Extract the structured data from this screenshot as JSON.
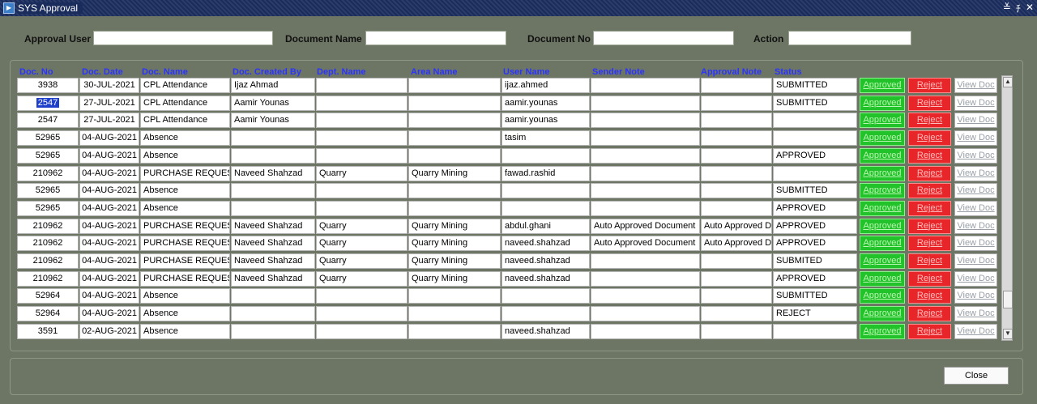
{
  "window": {
    "title": "SYS Approval",
    "buttons": [
      "≚",
      "ﾁ",
      "✕"
    ]
  },
  "filters": {
    "approval_user_label": "Approval User",
    "approval_user_value": "",
    "document_name_label": "Document Name",
    "document_name_value": "",
    "document_no_label": "Document No",
    "document_no_value": "",
    "action_label": "Action",
    "action_value": ""
  },
  "table": {
    "headers": {
      "doc_no": "Doc. No",
      "doc_date": "Doc. Date",
      "doc_name": "Doc. Name",
      "doc_created_by": "Doc. Created By",
      "dept_name": "Dept. Name",
      "area_name": "Area Name",
      "user_name": "User Name",
      "sender_note": "Sender  Note",
      "approval_note": "Approval Note",
      "status": "Status"
    },
    "buttons": {
      "approve": "Approved",
      "reject": "Reject",
      "view": "View Doc"
    },
    "rows": [
      {
        "doc_no": "3938",
        "doc_date": "30-JUL-2021",
        "doc_name": "CPL Attendance",
        "created_by": "Ijaz Ahmad",
        "dept": "",
        "area": "",
        "user": "ijaz.ahmed",
        "sender_note": "",
        "approval_note": "",
        "status": "SUBMITTED"
      },
      {
        "doc_no": "2547",
        "doc_date": "27-JUL-2021",
        "doc_name": "CPL Attendance",
        "created_by": "Aamir Younas",
        "dept": "",
        "area": "",
        "user": "aamir.younas",
        "sender_note": "",
        "approval_note": "",
        "status": "SUBMITTED"
      },
      {
        "doc_no": "2547",
        "doc_date": "27-JUL-2021",
        "doc_name": "CPL Attendance",
        "created_by": "Aamir Younas",
        "dept": "",
        "area": "",
        "user": "aamir.younas",
        "sender_note": "",
        "approval_note": "",
        "status": ""
      },
      {
        "doc_no": "52965",
        "doc_date": "04-AUG-2021",
        "doc_name": "Absence",
        "created_by": "",
        "dept": "",
        "area": "",
        "user": "tasim",
        "sender_note": "",
        "approval_note": "",
        "status": ""
      },
      {
        "doc_no": "52965",
        "doc_date": "04-AUG-2021",
        "doc_name": "Absence",
        "created_by": "",
        "dept": "",
        "area": "",
        "user": "",
        "sender_note": "",
        "approval_note": "",
        "status": "APPROVED"
      },
      {
        "doc_no": "210962",
        "doc_date": "04-AUG-2021",
        "doc_name": "PURCHASE REQUEST",
        "created_by": "Naveed Shahzad",
        "dept": "Quarry",
        "area": "Quarry Mining",
        "user": "fawad.rashid",
        "sender_note": "",
        "approval_note": "",
        "status": ""
      },
      {
        "doc_no": "52965",
        "doc_date": "04-AUG-2021",
        "doc_name": "Absence",
        "created_by": "",
        "dept": "",
        "area": "",
        "user": "",
        "sender_note": "",
        "approval_note": "",
        "status": "SUBMITTED"
      },
      {
        "doc_no": "52965",
        "doc_date": "04-AUG-2021",
        "doc_name": "Absence",
        "created_by": "",
        "dept": "",
        "area": "",
        "user": "",
        "sender_note": "",
        "approval_note": "",
        "status": "APPROVED"
      },
      {
        "doc_no": "210962",
        "doc_date": "04-AUG-2021",
        "doc_name": "PURCHASE REQUEST",
        "created_by": "Naveed Shahzad",
        "dept": "Quarry",
        "area": "Quarry Mining",
        "user": "abdul.ghani",
        "sender_note": "Auto Approved Document",
        "approval_note": "Auto Approved Do",
        "status": "APPROVED"
      },
      {
        "doc_no": "210962",
        "doc_date": "04-AUG-2021",
        "doc_name": "PURCHASE REQUEST",
        "created_by": "Naveed Shahzad",
        "dept": "Quarry",
        "area": "Quarry Mining",
        "user": "naveed.shahzad",
        "sender_note": "Auto Approved Document",
        "approval_note": "Auto Approved Do",
        "status": "APPROVED"
      },
      {
        "doc_no": "210962",
        "doc_date": "04-AUG-2021",
        "doc_name": "PURCHASE REQUEST",
        "created_by": "Naveed Shahzad",
        "dept": "Quarry",
        "area": "Quarry Mining",
        "user": "naveed.shahzad",
        "sender_note": "",
        "approval_note": "",
        "status": "SUBMITED"
      },
      {
        "doc_no": "210962",
        "doc_date": "04-AUG-2021",
        "doc_name": "PURCHASE REQUEST",
        "created_by": "Naveed Shahzad",
        "dept": "Quarry",
        "area": "Quarry Mining",
        "user": "naveed.shahzad",
        "sender_note": "",
        "approval_note": "",
        "status": "APPROVED"
      },
      {
        "doc_no": "52964",
        "doc_date": "04-AUG-2021",
        "doc_name": "Absence",
        "created_by": "",
        "dept": "",
        "area": "",
        "user": "",
        "sender_note": "",
        "approval_note": "",
        "status": "SUBMITTED"
      },
      {
        "doc_no": "52964",
        "doc_date": "04-AUG-2021",
        "doc_name": "Absence",
        "created_by": "",
        "dept": "",
        "area": "",
        "user": "",
        "sender_note": "",
        "approval_note": "",
        "status": "REJECT"
      },
      {
        "doc_no": "3591",
        "doc_date": "02-AUG-2021",
        "doc_name": "Absence",
        "created_by": "",
        "dept": "",
        "area": "",
        "user": "naveed.shahzad",
        "sender_note": "",
        "approval_note": "",
        "status": ""
      }
    ],
    "selected_row": 1
  },
  "footer": {
    "close_label": "Close"
  },
  "colors": {
    "approve": "#22c22a",
    "reject": "#e8262a",
    "header_text": "#2b33ff",
    "title_bar": "#1a2c5c"
  }
}
